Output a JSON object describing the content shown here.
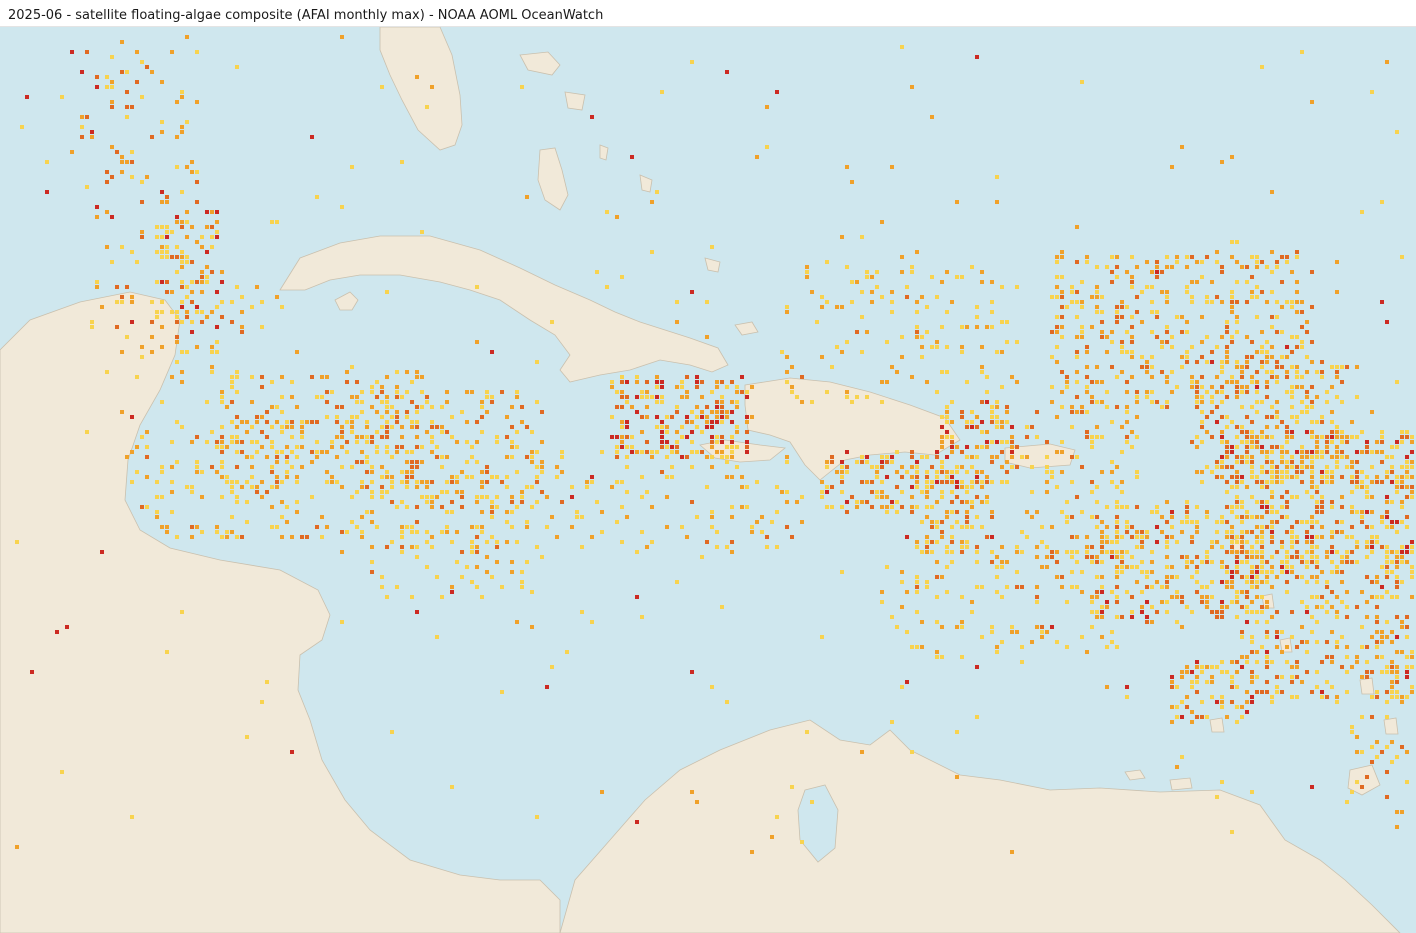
{
  "title": "2025-06 - satellite floating-algae composite (AFAI monthly max) - NOAA AOML OceanWatch",
  "colors": {
    "ocean": "#cfe7ee",
    "land": "#f1e9d9",
    "coast": "#c9c0ae",
    "low": "#f8d34f",
    "mid": "#f0a12a",
    "high": "#e06a22",
    "max": "#cc2a22"
  }
}
